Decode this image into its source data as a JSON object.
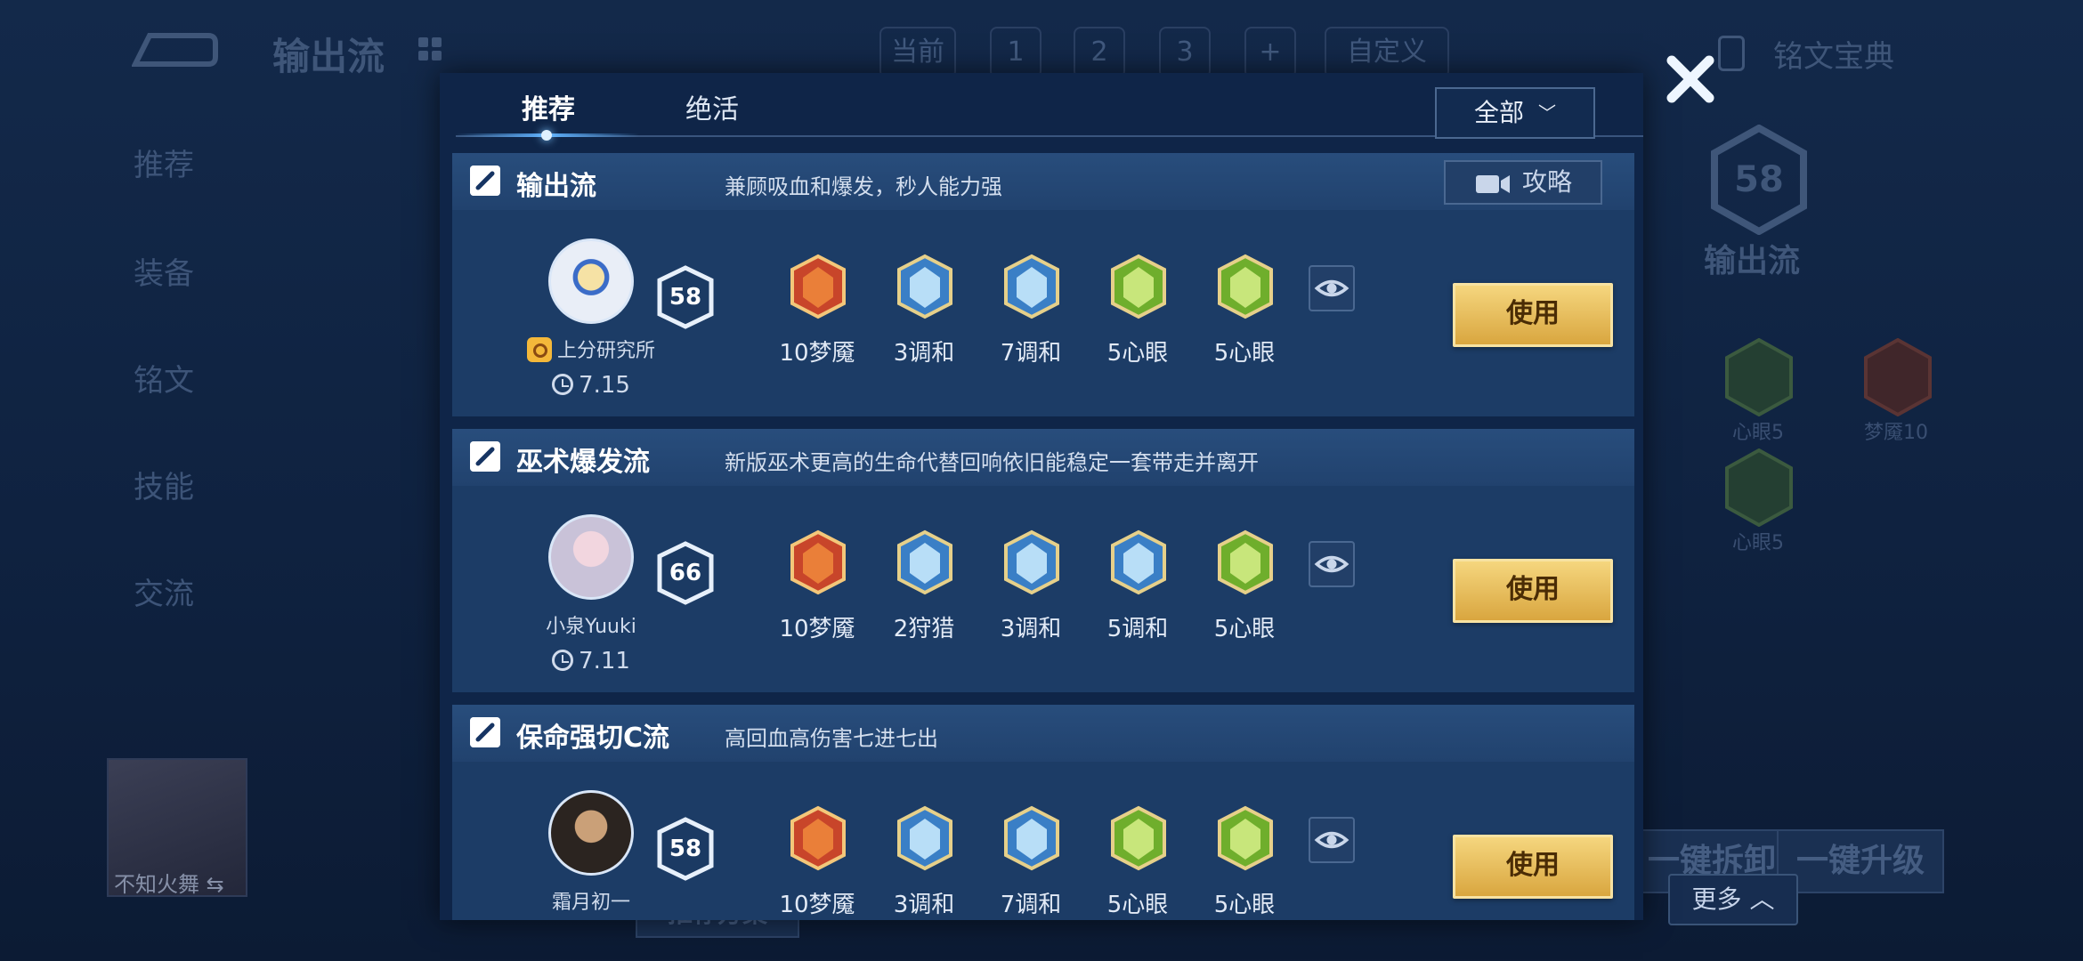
{
  "background": {
    "title": "输出流",
    "page_tabs": [
      "当前",
      "1",
      "2",
      "3",
      "+",
      "自定义"
    ],
    "right_title": "铭文宝典",
    "side_items": [
      "推荐",
      "装备",
      "铭文",
      "技能",
      "交流"
    ],
    "level": "58",
    "flow_name": "输出流",
    "runes": [
      {
        "label": "心眼5"
      },
      {
        "label": "梦魇10"
      },
      {
        "label": "心眼5"
      }
    ],
    "buttons": [
      "一键拆卸",
      "一键升级"
    ],
    "bottom_tabs": [
      "推荐方案"
    ],
    "avatar_name": "不知火舞",
    "more_label": "更多"
  },
  "modal": {
    "tabs": [
      {
        "label": "推荐",
        "active": true
      },
      {
        "label": "绝活",
        "active": false
      }
    ],
    "filter": "全部",
    "guide_label": "攻略",
    "use_label": "使用",
    "cards": [
      {
        "title": "输出流",
        "desc": "兼顾吸血和爆发，秒人能力强",
        "author": "上分研究所",
        "date": "7.15",
        "level": "58",
        "has_guide": true,
        "runes": [
          {
            "label": "10梦魇",
            "icon": "red-rune-icon"
          },
          {
            "label": "3调和",
            "icon": "blue-rune-icon"
          },
          {
            "label": "7调和",
            "icon": "blue-rune-icon"
          },
          {
            "label": "5心眼",
            "icon": "green-rune-icon"
          },
          {
            "label": "5心眼",
            "icon": "green-rune-icon"
          }
        ]
      },
      {
        "title": "巫术爆发流",
        "desc": "新版巫术更高的生命代替回响依旧能稳定一套带走并离开",
        "author": "小泉Yuuki",
        "date": "7.11",
        "level": "66",
        "has_guide": false,
        "runes": [
          {
            "label": "10梦魇",
            "icon": "red-rune-icon"
          },
          {
            "label": "2狩猎",
            "icon": "blue-rune-icon"
          },
          {
            "label": "3调和",
            "icon": "blue-rune-icon"
          },
          {
            "label": "5调和",
            "icon": "blue-rune-icon"
          },
          {
            "label": "5心眼",
            "icon": "green-rune-icon"
          }
        ]
      },
      {
        "title": "保命强切C流",
        "desc": "高回血高伤害七进七出",
        "author": "霜月初一",
        "date": "",
        "level": "58",
        "has_guide": false,
        "runes": [
          {
            "label": "10梦魇",
            "icon": "red-rune-icon"
          },
          {
            "label": "3调和",
            "icon": "blue-rune-icon"
          },
          {
            "label": "7调和",
            "icon": "blue-rune-icon"
          },
          {
            "label": "5心眼",
            "icon": "green-rune-icon"
          },
          {
            "label": "5心眼",
            "icon": "green-rune-icon"
          }
        ]
      }
    ]
  }
}
